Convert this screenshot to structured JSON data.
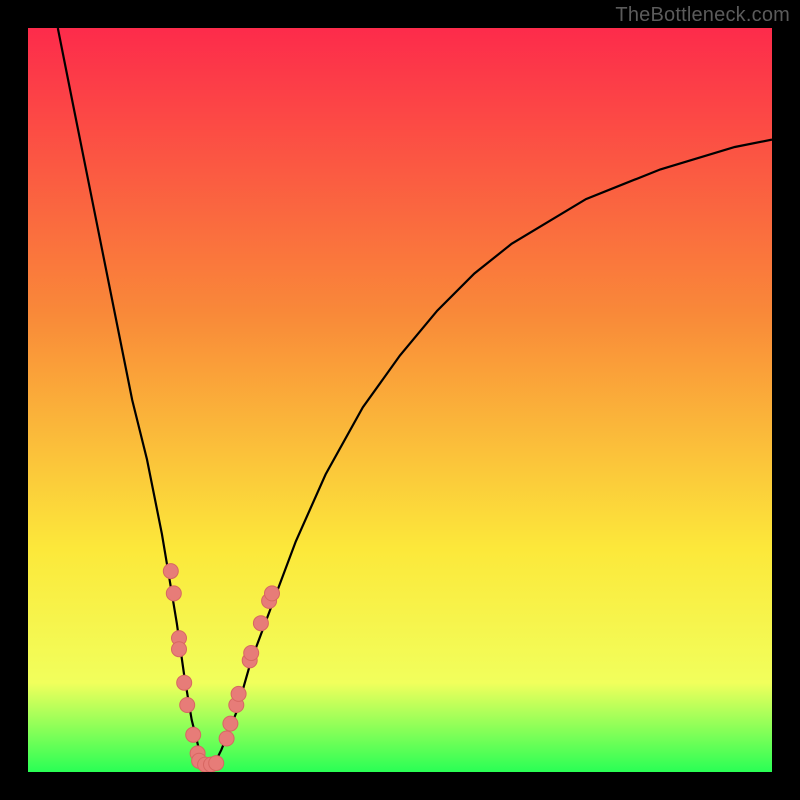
{
  "watermark": "TheBottleneck.com",
  "colors": {
    "frame": "#000000",
    "grad_top": "#fd2b4b",
    "grad_mid1": "#f98839",
    "grad_mid2": "#fce83a",
    "grad_band": "#f1ff5c",
    "grad_bottom": "#29ff55",
    "curve": "#000000",
    "dot_fill": "#e77c78",
    "dot_stroke": "#d76762"
  },
  "chart_data": {
    "type": "line",
    "title": "",
    "xlabel": "",
    "ylabel": "",
    "xlim": [
      0,
      100
    ],
    "ylim": [
      0,
      100
    ],
    "series": [
      {
        "name": "curve",
        "x": [
          4,
          6,
          8,
          10,
          12,
          14,
          16,
          18,
          19,
          20,
          21,
          22,
          23,
          24,
          25,
          26,
          28,
          30,
          33,
          36,
          40,
          45,
          50,
          55,
          60,
          65,
          70,
          75,
          80,
          85,
          90,
          95,
          100
        ],
        "y": [
          100,
          90,
          80,
          70,
          60,
          50,
          42,
          32,
          26,
          20,
          13,
          7,
          3,
          1,
          1,
          3,
          8,
          15,
          23,
          31,
          40,
          49,
          56,
          62,
          67,
          71,
          74,
          77,
          79,
          81,
          82.5,
          84,
          85
        ]
      }
    ],
    "points": [
      {
        "x": 19.2,
        "y": 27
      },
      {
        "x": 19.6,
        "y": 24
      },
      {
        "x": 20.3,
        "y": 18
      },
      {
        "x": 20.3,
        "y": 16.5
      },
      {
        "x": 21.0,
        "y": 12
      },
      {
        "x": 21.4,
        "y": 9
      },
      {
        "x": 22.2,
        "y": 5
      },
      {
        "x": 22.8,
        "y": 2.5
      },
      {
        "x": 23.0,
        "y": 1.5
      },
      {
        "x": 23.8,
        "y": 1.0
      },
      {
        "x": 24.6,
        "y": 1.0
      },
      {
        "x": 25.3,
        "y": 1.2
      },
      {
        "x": 26.7,
        "y": 4.5
      },
      {
        "x": 27.2,
        "y": 6.5
      },
      {
        "x": 28.0,
        "y": 9
      },
      {
        "x": 28.3,
        "y": 10.5
      },
      {
        "x": 29.8,
        "y": 15
      },
      {
        "x": 30.0,
        "y": 16
      },
      {
        "x": 31.3,
        "y": 20
      },
      {
        "x": 32.4,
        "y": 23
      },
      {
        "x": 32.8,
        "y": 24
      }
    ]
  }
}
